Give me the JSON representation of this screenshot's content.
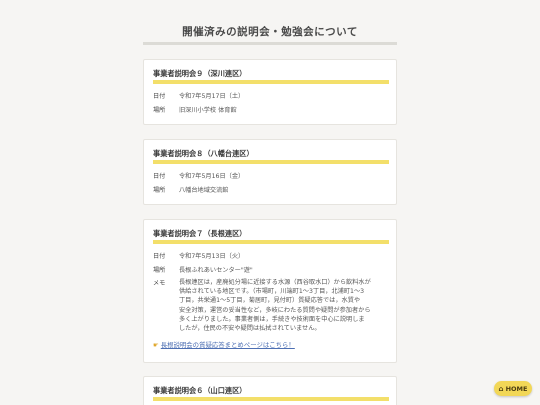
{
  "page": {
    "title": "開催済みの説明会・勉強会について"
  },
  "cards": [
    {
      "title": "事業者説明会９（深川連区）",
      "date_label": "日付",
      "date": "令和7年5月17日（土）",
      "place_label": "場所",
      "place": "旧深川小学校 体育館"
    },
    {
      "title": "事業者説明会８（八幡台連区）",
      "date_label": "日付",
      "date": "令和7年5月16日（金）",
      "place_label": "場所",
      "place": "八幡台地域交流館"
    },
    {
      "title": "事業者説明会７（長根連区）",
      "date_label": "日付",
      "date": "令和7年5月13日（火）",
      "place_label": "場所",
      "place": "長根ふれあいセンター\"遊\"",
      "memo_label": "メモ",
      "memo": "長根連区は，産廃処分場に近接する水源（西谷取水口）から飲料水が\n供給されている地区です。（市場町，川端町1〜3丁目，北浦町1〜3\n丁目，共栄通1〜5丁目，菊居町，見付町）質疑応答では，水質や\n安全対策，運営の妥当性など，多岐にわたる質問や疑問が参加者から\n多く上がりました。事業者側は，手続きや技術面を中心に説明しま\nしたが，住民の不安や疑問は払拭されていません。",
      "link": "長根説明会の質疑応答まとめページはこちら！"
    },
    {
      "title": "事業者説明会６（山口連区）"
    }
  ],
  "home_button": {
    "label": "HOME",
    "icon": "home-icon"
  },
  "colors": {
    "accent": "#f3df6a",
    "background": "#f6f5f3"
  }
}
